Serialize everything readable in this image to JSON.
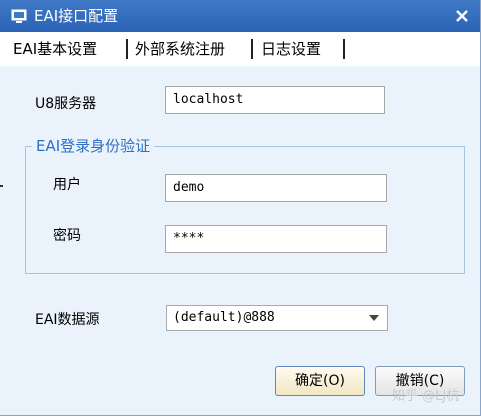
{
  "window": {
    "title": "EAI接口配置",
    "icons": {
      "app": "app-window-icon",
      "close": "close-icon"
    },
    "colors": {
      "titlebar": "#2f6dbd",
      "content_bg": "#eaf2fc",
      "group_legend": "#2f6fc4"
    }
  },
  "tabs": [
    {
      "label": "EAI基本设置",
      "active": true
    },
    {
      "label": "外部系统注册",
      "active": false
    },
    {
      "label": "日志设置",
      "active": false
    }
  ],
  "form": {
    "server_label": "U8服务器",
    "server_value": "localhost",
    "auth_group": {
      "legend": "EAI登录身份验证",
      "user_label": "用户",
      "user_value": "demo",
      "password_label": "密码",
      "password_value": "****"
    },
    "datasource_label": "EAI数据源",
    "datasource_value": "(default)@888",
    "datasource_icon": "chevron-down-icon"
  },
  "buttons": {
    "ok_label": "确定(O)",
    "cancel_label": "撤销(C)"
  },
  "watermark": {
    "text": "知乎 @LJ杭"
  }
}
